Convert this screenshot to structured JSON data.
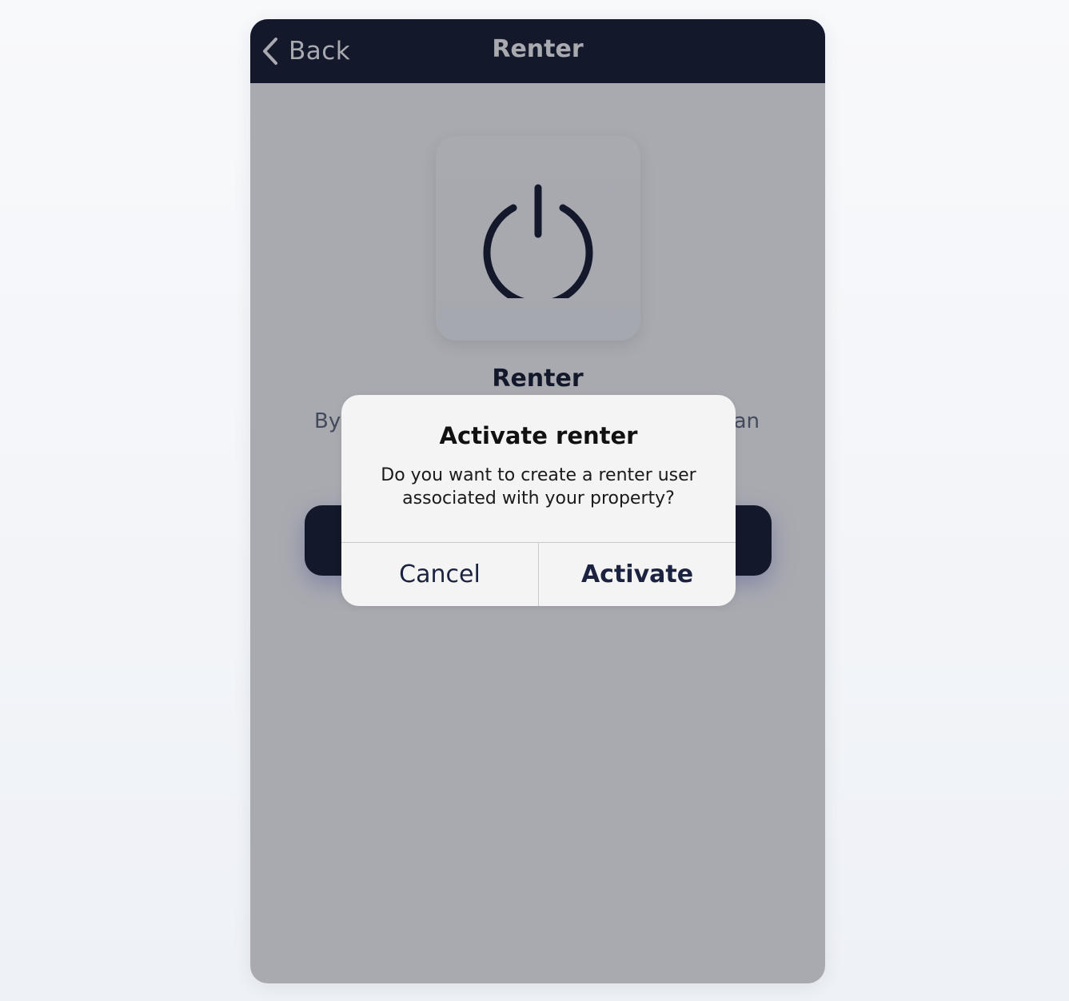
{
  "nav": {
    "back_label": "Back",
    "title": "Renter"
  },
  "main": {
    "icon": "power-icon",
    "title": "Renter",
    "description": "By                                                      an",
    "primary_button_label": ""
  },
  "alert": {
    "title": "Activate renter",
    "message": "Do you want to create a renter user associated with your property?",
    "cancel_label": "Cancel",
    "confirm_label": "Activate"
  },
  "colors": {
    "nav_background": "#0f1429",
    "primary": "#0f1429",
    "overlay": "rgba(30, 32, 48, 0.38)",
    "alert_background": "#f4f4f5"
  }
}
